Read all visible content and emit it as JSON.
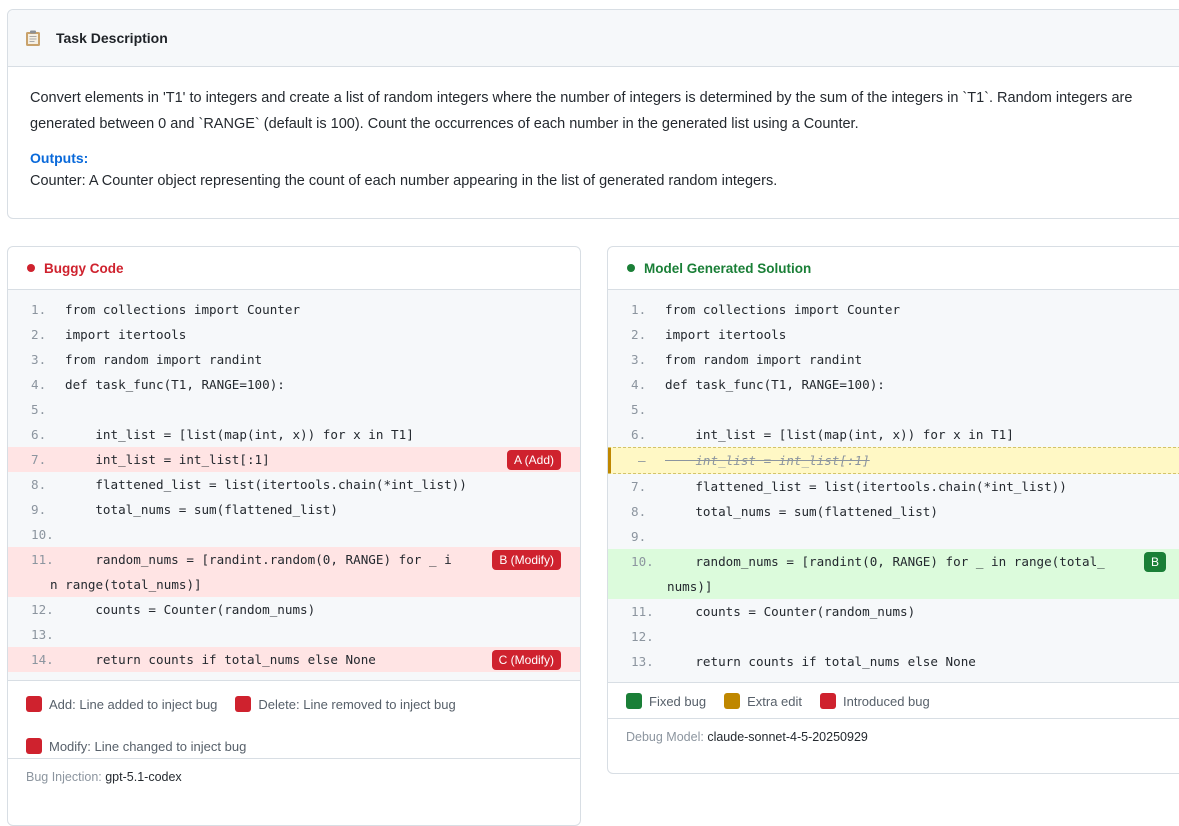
{
  "task": {
    "title": "Task Description",
    "description": "Convert elements in 'T1' to integers and create a list of random integers where the number of integers is determined by the sum of the integers in `T1`. Random integers are generated between 0 and `RANGE` (default is 100). Count the occurrences of each number in the generated list using a Counter.",
    "outputs_label": "Outputs:",
    "outputs_text": "Counter: A Counter object representing the count of each number appearing in the list of generated random integers."
  },
  "buggy": {
    "title": "Buggy Code",
    "lines": [
      {
        "n": "1.",
        "code": "from collections import Counter"
      },
      {
        "n": "2.",
        "code": "import itertools"
      },
      {
        "n": "3.",
        "code": "from random import randint"
      },
      {
        "n": "4.",
        "code": "def task_func(T1, RANGE=100):"
      },
      {
        "n": "5.",
        "code": ""
      },
      {
        "n": "6.",
        "code": "    int_list = [list(map(int, x)) for x in T1]"
      },
      {
        "n": "7.",
        "code": "    int_list = int_list[:1]",
        "badge": "A (Add)"
      },
      {
        "n": "8.",
        "code": "    flattened_list = list(itertools.chain(*int_list))"
      },
      {
        "n": "9.",
        "code": "    total_nums = sum(flattened_list)"
      },
      {
        "n": "10.",
        "code": ""
      },
      {
        "n": "11.",
        "code": "    random_nums = [randint.random(0, RANGE) for _ i",
        "cont": "n range(total_nums)]",
        "badge": "B (Modify)"
      },
      {
        "n": "12.",
        "code": "    counts = Counter(random_nums)"
      },
      {
        "n": "13.",
        "code": ""
      },
      {
        "n": "14.",
        "code": "    return counts if total_nums else None",
        "badge": "C (Modify)"
      }
    ],
    "legend": {
      "add": "Add: Line added to inject bug",
      "delete": "Delete: Line removed to inject bug",
      "modify": "Modify: Line changed to inject bug"
    },
    "footer_label": "Bug Injection:",
    "footer_value": "gpt-5.1-codex"
  },
  "solution": {
    "title": "Model Generated Solution",
    "lines": [
      {
        "n": "1.",
        "code": "from collections import Counter"
      },
      {
        "n": "2.",
        "code": "import itertools"
      },
      {
        "n": "3.",
        "code": "from random import randint"
      },
      {
        "n": "4.",
        "code": "def task_func(T1, RANGE=100):"
      },
      {
        "n": "5.",
        "code": ""
      },
      {
        "n": "6.",
        "code": "    int_list = [list(map(int, x)) for x in T1]"
      },
      {
        "n": "–",
        "code": "    int_list = int_list[:1]"
      },
      {
        "n": "7.",
        "code": "    flattened_list = list(itertools.chain(*int_list))"
      },
      {
        "n": "8.",
        "code": "    total_nums = sum(flattened_list)"
      },
      {
        "n": "9.",
        "code": ""
      },
      {
        "n": "10.",
        "code": "    random_nums = [randint(0, RANGE) for _ in range(total_",
        "cont": "nums)]",
        "badge": "B"
      },
      {
        "n": "11.",
        "code": "    counts = Counter(random_nums)"
      },
      {
        "n": "12.",
        "code": ""
      },
      {
        "n": "13.",
        "code": "    return counts if total_nums else None"
      }
    ],
    "legend": {
      "fixed": "Fixed bug",
      "extra": "Extra edit",
      "introduced": "Introduced bug"
    },
    "footer_label": "Debug Model:",
    "footer_value": "claude-sonnet-4-5-20250929"
  },
  "colors": {
    "red": "#cf222e",
    "green": "#1a7f37",
    "orange": "#bf8700",
    "blue": "#0969da"
  }
}
